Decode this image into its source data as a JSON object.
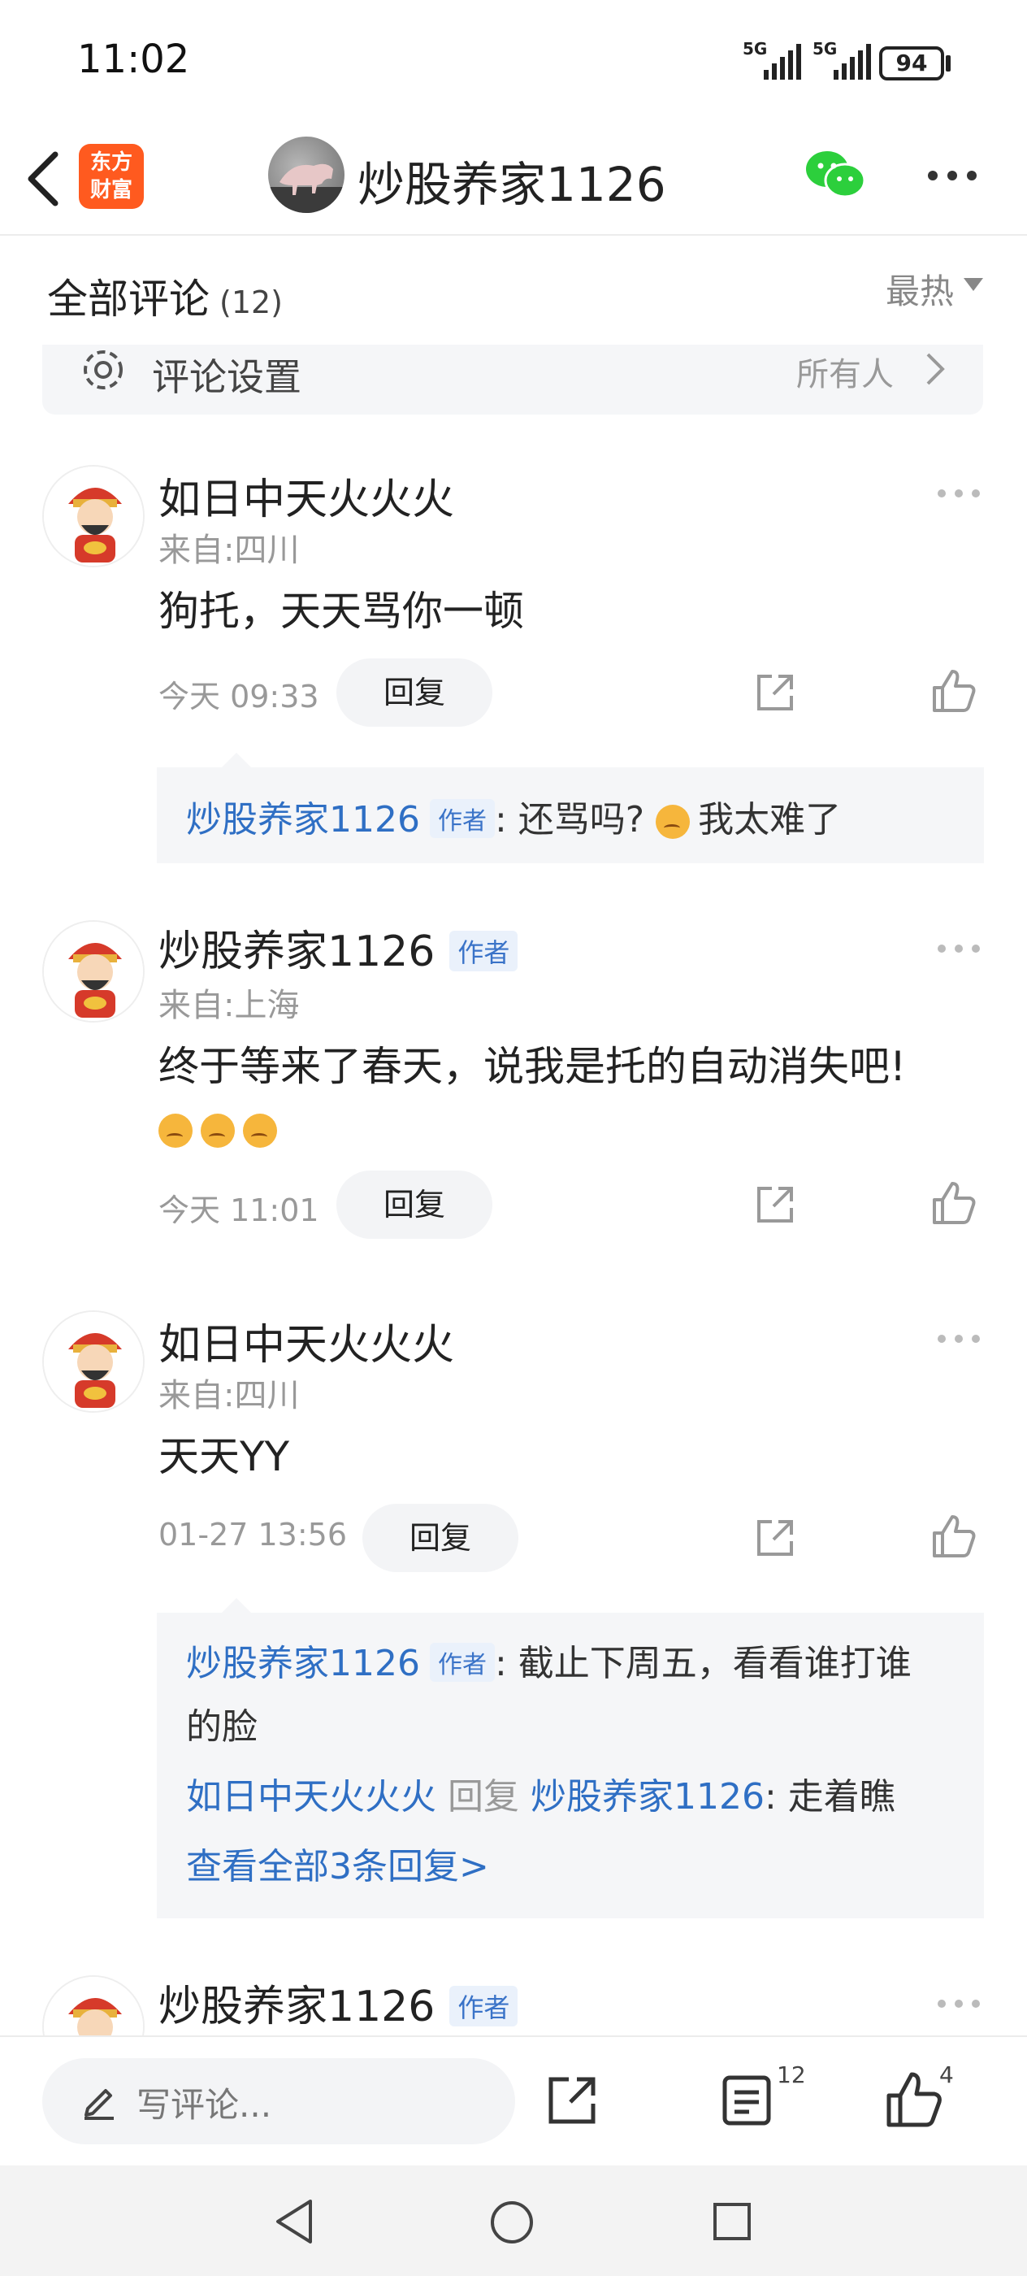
{
  "status_bar": {
    "time": "11:02",
    "network1": "5G",
    "network2": "5G",
    "battery": "94"
  },
  "header": {
    "logo_line1": "东方",
    "logo_line2": "财富",
    "title": "炒股养家1126"
  },
  "comments_header": {
    "title": "全部评论",
    "count": "(12)",
    "sort": "最热"
  },
  "settings": {
    "label": "评论设置",
    "value": "所有人"
  },
  "author_tag": "作者",
  "reply_label": "回复",
  "comments": [
    {
      "name": "如日中天火火火",
      "location": "来自:四川",
      "content": "狗托，天天骂你一顿",
      "time": "今天 09:33",
      "replies": [
        {
          "name": "炒股养家1126",
          "text": ": 还骂吗? ",
          "text2": "我太难了"
        }
      ]
    },
    {
      "name": "炒股养家1126",
      "location": "来自:上海",
      "content": "终于等来了春天，说我是托的自动消失吧!",
      "time": "今天 11:01"
    },
    {
      "name": "如日中天火火火",
      "location": "来自:四川",
      "content": "天天YY",
      "time": "01-27 13:56",
      "replies": [
        {
          "name": "炒股养家1126",
          "text": ": 截止下周五，看看谁打谁",
          "text_cont": "的脸"
        },
        {
          "name": "如日中天火火火",
          "mid": "回复",
          "target": "炒股养家1126",
          "text": ": 走着瞧"
        }
      ],
      "view_all": "查看全部3条回复>"
    },
    {
      "name": "炒股养家1126"
    }
  ],
  "bottom_bar": {
    "placeholder": "写评论...",
    "comment_count": "12",
    "like_count": "4"
  },
  "colors": {
    "link_blue": "#2f6fc4",
    "logo_orange": "#ff5a1f",
    "wechat_green": "#2ccf3c"
  }
}
